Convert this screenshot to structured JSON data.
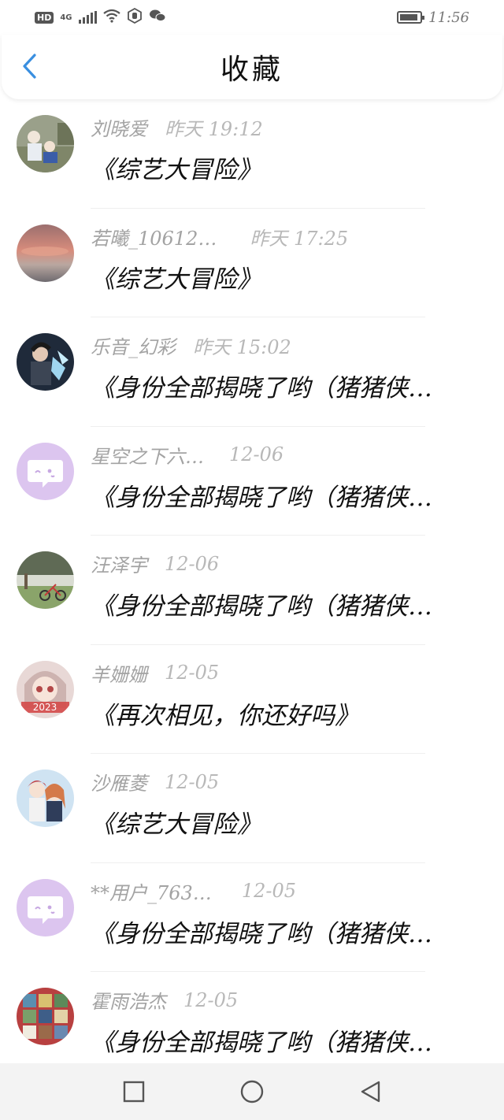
{
  "status_bar": {
    "hd": "HD",
    "network": "4G",
    "time": "11:56"
  },
  "header": {
    "title": "收藏",
    "back_icon": "chevron-left-icon",
    "accent": "#3a8fe0"
  },
  "items": [
    {
      "user": "刘晓爱",
      "time": "昨天 19:12",
      "title": "《综艺大冒险》",
      "avatar": "photo-family"
    },
    {
      "user": "若曦_10612…",
      "time": "昨天 17:25",
      "title": "《综艺大冒险》",
      "avatar": "photo-sunset"
    },
    {
      "user": "乐音_幻彩",
      "time": "昨天 15:02",
      "title": "《身份全部揭晓了哟（猪猪侠…",
      "avatar": "photo-anime-dark"
    },
    {
      "user": "星空之下六…",
      "time": "12-06",
      "title": "《身份全部揭晓了哟（猪猪侠…",
      "avatar": "default-chat"
    },
    {
      "user": "汪泽宇",
      "time": "12-06",
      "title": "《身份全部揭晓了哟（猪猪侠…",
      "avatar": "photo-bike"
    },
    {
      "user": "羊姗姗",
      "time": "12-05",
      "title": "《再次相见，你还好吗》",
      "avatar": "photo-anime-girl"
    },
    {
      "user": "沙雁菱",
      "time": "12-05",
      "title": "《综艺大冒险》",
      "avatar": "photo-anime-couple"
    },
    {
      "user": "**用户_763…",
      "time": "12-05",
      "title": "《身份全部揭晓了哟（猪猪侠…",
      "avatar": "default-chat"
    },
    {
      "user": "霍雨浩杰",
      "time": "12-05",
      "title": "《身份全部揭晓了哟（猪猪侠…",
      "avatar": "photo-collage"
    }
  ],
  "navbar": {
    "square": "square-icon",
    "circle": "circle-icon",
    "triangle": "triangle-back-icon"
  }
}
